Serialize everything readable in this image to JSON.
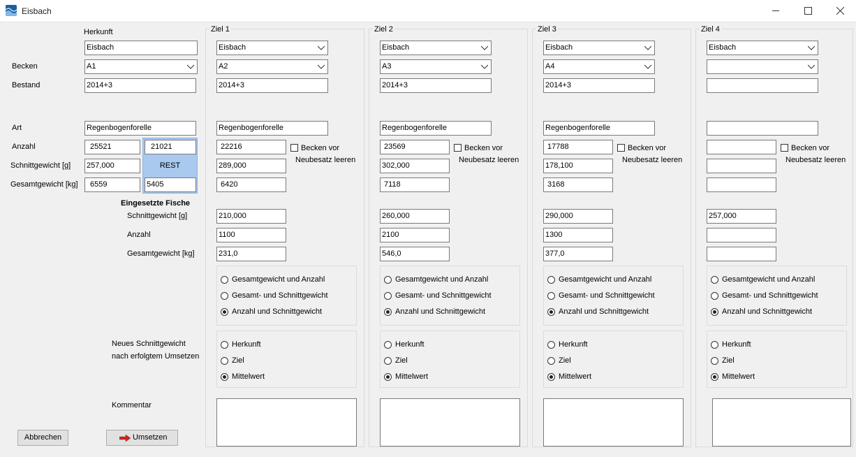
{
  "window": {
    "title": "Eisbach"
  },
  "herkunft": {
    "header": "Herkunft",
    "gewaesser": "Eisbach",
    "becken": "A1",
    "bestand": "2014+3",
    "art": "Regenbogenforelle",
    "anzahl": "25521",
    "schnittgewicht": "257,000",
    "gesamtgewicht": "6559",
    "rest_anzahl": "21021",
    "rest_label": "REST",
    "rest_gesamtgewicht": "5405"
  },
  "labels": {
    "becken": "Becken",
    "bestand": "Bestand",
    "art": "Art",
    "anzahl": "Anzahl",
    "schnittgewicht": "Schnittgewicht [g]",
    "gesamtgewicht": "Gesamtgewicht [kg]",
    "eingesetzte_fische": "Eingesetzte Fische",
    "e_schnittgewicht": "Schnittgewicht [g]",
    "e_anzahl": "Anzahl",
    "e_gesamtgewicht": "Gesamtgewicht [kg]",
    "neues_line1": "Neues Schnittgewicht",
    "neues_line2": "nach erfolgtem Umsetzen",
    "kommentar": "Kommentar",
    "becken_vor_1": "Becken vor",
    "becken_vor_2": "Neubesatz leeren"
  },
  "mode_options": [
    "Gesamtgewicht und Anzahl",
    "Gesamt- und Schnittgewicht",
    "Anzahl und Schnittgewicht"
  ],
  "neues_options": [
    "Herkunft",
    "Ziel",
    "Mittelwert"
  ],
  "ziele": [
    {
      "title": "Ziel 1",
      "gewaesser": "Eisbach",
      "becken": "A2",
      "bestand": "2014+3",
      "art": "Regenbogenforelle",
      "anzahl": "22216",
      "schnittgewicht": "289,000",
      "gesamtgewicht": "6420",
      "e_schnittgewicht": "210,000",
      "e_anzahl": "1100",
      "e_gesamtgewicht": "231,0"
    },
    {
      "title": "Ziel 2",
      "gewaesser": "Eisbach",
      "becken": "A3",
      "bestand": "2014+3",
      "art": "Regenbogenforelle",
      "anzahl": "23569",
      "schnittgewicht": "302,000",
      "gesamtgewicht": "7118",
      "e_schnittgewicht": "260,000",
      "e_anzahl": "2100",
      "e_gesamtgewicht": "546,0"
    },
    {
      "title": "Ziel 3",
      "gewaesser": "Eisbach",
      "becken": "A4",
      "bestand": "2014+3",
      "art": "Regenbogenforelle",
      "anzahl": "17788",
      "schnittgewicht": "178,100",
      "gesamtgewicht": "3168",
      "e_schnittgewicht": "290,000",
      "e_anzahl": "1300",
      "e_gesamtgewicht": "377,0"
    },
    {
      "title": "Ziel 4",
      "gewaesser": "Eisbach",
      "becken": "",
      "bestand": "",
      "art": "",
      "anzahl": "",
      "schnittgewicht": "",
      "gesamtgewicht": "",
      "e_schnittgewicht": "257,000",
      "e_anzahl": "",
      "e_gesamtgewicht": ""
    }
  ],
  "buttons": {
    "cancel": "Abbrechen",
    "submit": "Umsetzen"
  },
  "colors": {
    "rest_highlight": "#a9c9ee",
    "submit_arrow": "#d42020"
  }
}
